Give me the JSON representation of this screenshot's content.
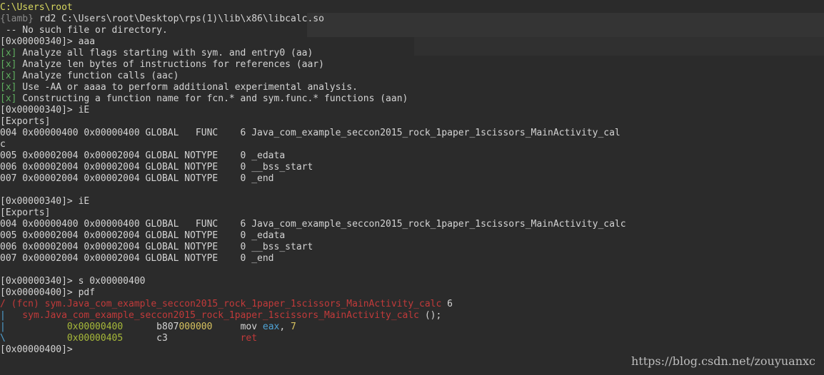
{
  "terminal": {
    "lines": [
      [
        {
          "t": "C:\\Users\\root",
          "c": "yellow"
        }
      ],
      [
        {
          "t": "{lamb}",
          "c": "grey"
        },
        {
          "t": " rd2 C:\\Users\\root\\Desktop\\rps(1)\\lib\\x86\\libcalc.so"
        }
      ],
      [
        {
          "t": " -- No such file or directory."
        }
      ],
      [
        {
          "t": "[0x00000340]> aaa"
        }
      ],
      [
        {
          "t": "[x]",
          "c": "green"
        },
        {
          "t": " Analyze all flags starting with sym. and entry0 (aa)"
        }
      ],
      [
        {
          "t": "[x]",
          "c": "green"
        },
        {
          "t": " Analyze len bytes of instructions for references (aar)"
        }
      ],
      [
        {
          "t": "[x]",
          "c": "green"
        },
        {
          "t": " Analyze function calls (aac)"
        }
      ],
      [
        {
          "t": "[x]",
          "c": "green"
        },
        {
          "t": " Use -AA or aaaa to perform additional experimental analysis."
        }
      ],
      [
        {
          "t": "[x]",
          "c": "green"
        },
        {
          "t": " Constructing a function name for fcn.* and sym.func.* functions (aan)"
        }
      ],
      [
        {
          "t": "[0x00000340]> iE"
        }
      ],
      [
        {
          "t": "[Exports]"
        }
      ],
      [
        {
          "t": "004 0x00000400 0x00000400 GLOBAL   FUNC    6 Java_com_example_seccon2015_rock_1paper_1scissors_MainActivity_cal"
        }
      ],
      [
        {
          "t": "c"
        }
      ],
      [
        {
          "t": "005 0x00002004 0x00002004 GLOBAL NOTYPE    0 _edata"
        }
      ],
      [
        {
          "t": "006 0x00002004 0x00002004 GLOBAL NOTYPE    0 __bss_start"
        }
      ],
      [
        {
          "t": "007 0x00002004 0x00002004 GLOBAL NOTYPE    0 _end"
        }
      ],
      [
        {
          "t": ""
        }
      ],
      [
        {
          "t": "[0x00000340]> iE"
        }
      ],
      [
        {
          "t": "[Exports]"
        }
      ],
      [
        {
          "t": "004 0x00000400 0x00000400 GLOBAL   FUNC    6 Java_com_example_seccon2015_rock_1paper_1scissors_MainActivity_calc"
        }
      ],
      [
        {
          "t": "005 0x00002004 0x00002004 GLOBAL NOTYPE    0 _edata"
        }
      ],
      [
        {
          "t": "006 0x00002004 0x00002004 GLOBAL NOTYPE    0 __bss_start"
        }
      ],
      [
        {
          "t": "007 0x00002004 0x00002004 GLOBAL NOTYPE    0 _end"
        }
      ],
      [
        {
          "t": ""
        }
      ],
      [
        {
          "t": "[0x00000340]> s 0x00000400"
        }
      ],
      [
        {
          "t": "[0x00000400]> pdf"
        }
      ],
      [
        {
          "t": "/ (fcn) sym.Java_com_example_seccon2015_rock_1paper_1scissors_MainActivity_calc",
          "c": "red"
        },
        {
          "t": " 6"
        }
      ],
      [
        {
          "t": "|",
          "c": "blue"
        },
        {
          "t": "   sym.Java_com_example_seccon2015_rock_1paper_1scissors_MainActivity_calc",
          "c": "red"
        },
        {
          "t": " ();"
        }
      ],
      [
        {
          "t": "|",
          "c": "blue"
        },
        {
          "t": "           "
        },
        {
          "t": "0x00000400",
          "c": "ygreen"
        },
        {
          "t": "      b807"
        },
        {
          "t": "000000",
          "c": "gold"
        },
        {
          "t": "     mov "
        },
        {
          "t": "eax",
          "c": "blue"
        },
        {
          "t": ", "
        },
        {
          "t": "7",
          "c": "gold"
        }
      ],
      [
        {
          "t": "\\",
          "c": "blue"
        },
        {
          "t": "           "
        },
        {
          "t": "0x00000405",
          "c": "ygreen"
        },
        {
          "t": "      c3             "
        },
        {
          "t": "ret",
          "c": "red"
        }
      ],
      [
        {
          "t": "[0x00000400]>"
        }
      ]
    ]
  },
  "watermark": "https://blog.csdn.net/zouyuanxc"
}
